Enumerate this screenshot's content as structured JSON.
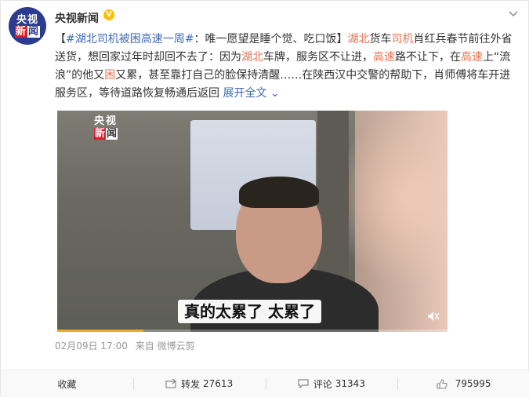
{
  "account": {
    "name": "央视新闻",
    "verified_badge": "V",
    "avatar_line1": "央视",
    "avatar_line2_a": "新",
    "avatar_line2_b": "闻"
  },
  "post": {
    "bracket_open": "【",
    "hashtag": "#湖北司机被困高速一周#",
    "headline": "：唯一愿望是睡个觉、吃口饭】",
    "seg1": "湖北",
    "seg2": "货车",
    "seg3": "司机",
    "seg4": "肖红兵春节前往外省送货，想回家过年时却回不去了：因为",
    "seg5": "湖北",
    "seg6": "车牌，服务区不让进，",
    "seg7": "高速",
    "seg8": "路不让下，在",
    "seg9": "高速",
    "seg10": "上“流浪”的他又",
    "seg11": "困",
    "seg12": "又累，甚至靠打自己的脸保持清醒……在陕西汉中交警的帮助下，肖师傅将车开进服务区，等待道路恢复畅通后返回",
    "expand_label": "展开全文",
    "expand_icon": "chevron-down-icon"
  },
  "video": {
    "logo_line1": "央视",
    "logo_line2_a": "新",
    "logo_line2_b": "闻",
    "subtitle": "真的太累了 太累了",
    "progress": 0.22
  },
  "meta": {
    "time": "02月09日 17:00",
    "source": "来自 微博云剪"
  },
  "actions": {
    "favorite": {
      "label": "收藏"
    },
    "repost": {
      "label": "转发",
      "count": "27613"
    },
    "comment": {
      "label": "评论",
      "count": "31343"
    },
    "like": {
      "count": "795995"
    }
  }
}
